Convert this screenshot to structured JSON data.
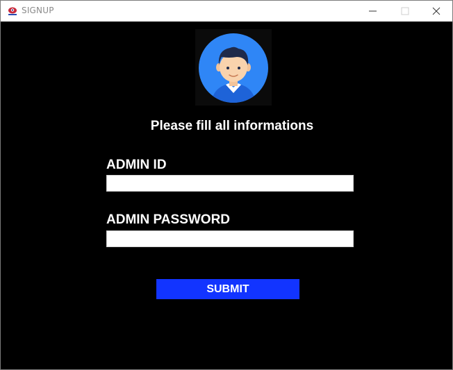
{
  "window": {
    "title": "SIGNUP",
    "icon": "app-icon"
  },
  "title_controls": [
    "minimize-icon",
    "maximize-icon",
    "close-icon"
  ],
  "form": {
    "avatar_icon": "user-avatar-icon",
    "heading": "Please fill all informations",
    "admin_id": {
      "label": "ADMIN ID",
      "value": ""
    },
    "admin_password": {
      "label": "ADMIN PASSWORD",
      "value": ""
    },
    "submit_label": "SUBMIT"
  },
  "colors": {
    "background": "#000000",
    "titlebar": "#ffffff",
    "submit_button": "#1234ff",
    "avatar_circle": "#2f86f6",
    "text": "#ffffff"
  }
}
